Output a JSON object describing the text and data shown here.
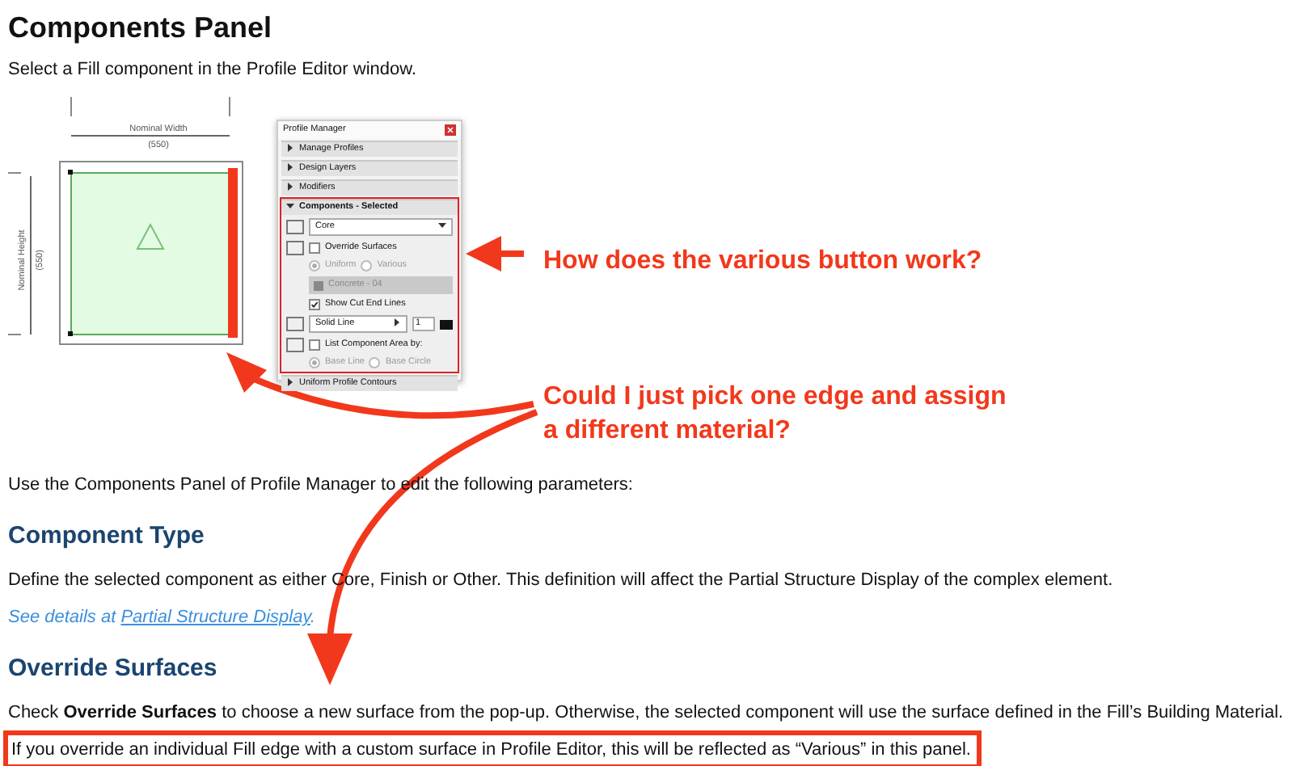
{
  "title": "Components Panel",
  "intro": "Select a Fill component in the Profile Editor window.",
  "drawing": {
    "width_label": "Nominal Width",
    "width_value": "(550)",
    "height_label": "Nominal Height",
    "height_value": "(550)"
  },
  "panel": {
    "title": "Profile Manager",
    "sections": [
      {
        "label": "Manage Profiles",
        "expanded": false,
        "highlighted": false
      },
      {
        "label": "Design Layers",
        "expanded": false,
        "highlighted": false
      },
      {
        "label": "Modifiers",
        "expanded": false,
        "highlighted": false
      },
      {
        "label": "Components - Selected",
        "expanded": true,
        "highlighted": true
      },
      {
        "label": "Uniform Profile Contours",
        "expanded": false,
        "highlighted": false
      }
    ],
    "component_type": "Core",
    "override_surfaces": {
      "label": "Override Surfaces",
      "checked": false
    },
    "surface_modes": [
      {
        "label": "Uniform",
        "selected": true
      },
      {
        "label": "Various",
        "selected": false
      }
    ],
    "surface": {
      "label": "Concrete - 04",
      "disabled": true
    },
    "cut_end_lines": {
      "label": "Show Cut End Lines",
      "checked": true
    },
    "line_type": "Solid Line",
    "pen": "1",
    "list_area": {
      "label": "List Component Area by:",
      "checked": false
    },
    "area_modes": [
      {
        "label": "Base Line",
        "selected": true
      },
      {
        "label": "Base Circle",
        "selected": false
      }
    ]
  },
  "annotations": [
    "How does the various button work?",
    "Could I just pick one edge and assign\na different material?"
  ],
  "usage": "Use the Components Panel of Profile Manager to edit the following parameters:",
  "sections": [
    {
      "heading": "Component Type",
      "text": "Define the selected component as either Core, Finish or Other. This definition will affect the Partial Structure Display of the complex element.",
      "link_prefix": "See details at ",
      "link": "Partial Structure Display",
      "link_suffix": "."
    },
    {
      "heading": "Override Surfaces",
      "text": "Check **Override Surfaces** to choose a new surface from the pop-up. Otherwise, the selected component will use the surface defined in the Fill’s Building Material.",
      "note": "If you override an individual Fill edge with a custom surface in Profile Editor, this will be reflected as “Various” in this panel."
    }
  ]
}
